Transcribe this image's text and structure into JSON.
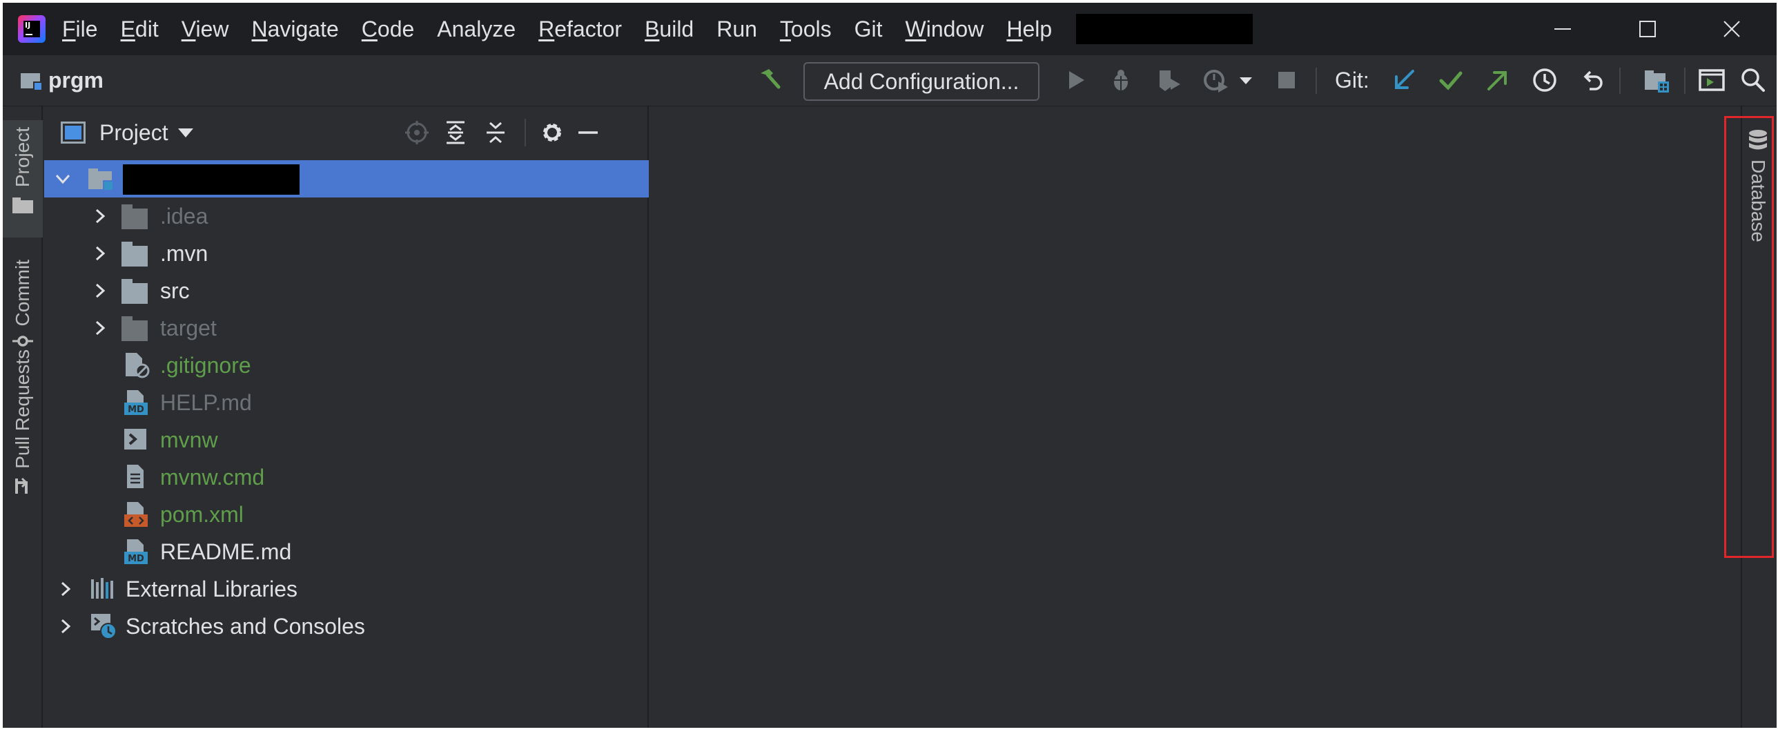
{
  "menubar": {
    "items": [
      {
        "mnemonic": "F",
        "rest": "ile"
      },
      {
        "mnemonic": "E",
        "rest": "dit"
      },
      {
        "mnemonic": "V",
        "rest": "iew"
      },
      {
        "mnemonic": "N",
        "rest": "avigate"
      },
      {
        "mnemonic": "C",
        "rest": "ode"
      },
      {
        "mnemonic": "",
        "rest": "Analyze"
      },
      {
        "mnemonic": "R",
        "rest": "efactor"
      },
      {
        "mnemonic": "B",
        "rest": "uild"
      },
      {
        "mnemonic": "",
        "rest": "Run"
      },
      {
        "mnemonic": "T",
        "rest": "ools"
      },
      {
        "mnemonic": "",
        "rest": "Git"
      },
      {
        "mnemonic": "W",
        "rest": "indow"
      },
      {
        "mnemonic": "H",
        "rest": "elp"
      }
    ]
  },
  "toolbar": {
    "project_name": "prgm",
    "add_configuration": "Add Configuration...",
    "git_label": "Git:"
  },
  "left_tabs": {
    "project": "Project",
    "commit": "Commit",
    "pull_requests": "Pull Requests"
  },
  "panel": {
    "title": "Project"
  },
  "tree": {
    "idea": ".idea",
    "mvn": ".mvn",
    "src": "src",
    "target": "target",
    "gitignore": ".gitignore",
    "help": "HELP.md",
    "mvnw": "mvnw",
    "mvnw_cmd": "mvnw.cmd",
    "pom": "pom.xml",
    "readme": "README.md",
    "external_libraries": "External Libraries",
    "scratches": "Scratches and Consoles"
  },
  "right_tabs": {
    "database": "Database"
  },
  "colors": {
    "accent_selection": "#4a78d0",
    "vcs_added_green": "#5f9e4a",
    "ignored_gray": "#6e7378",
    "highlight_box": "#e0262a"
  }
}
